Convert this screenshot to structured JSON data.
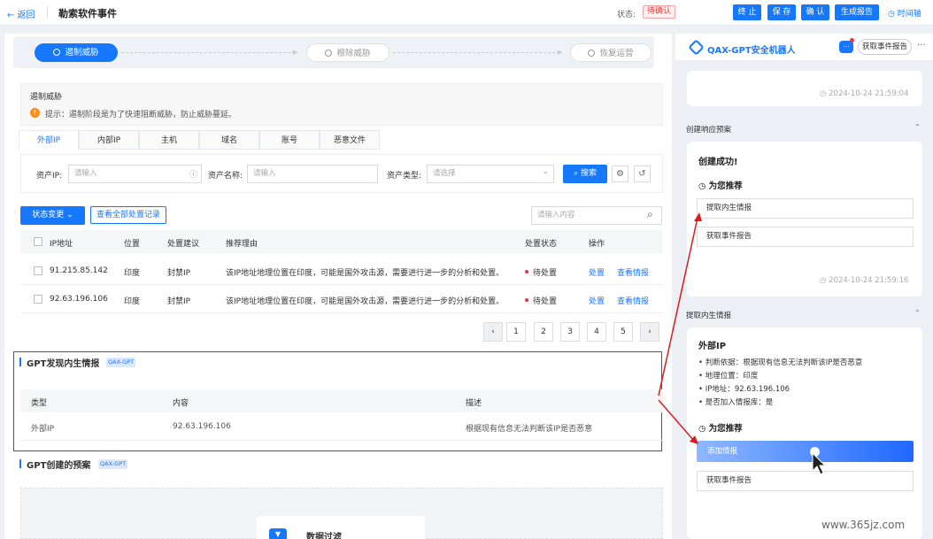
{
  "header": {
    "back": "← 返回",
    "title": "勒索软件事件",
    "status_label": "状态:",
    "status_value": "待确认",
    "btn_terminate": "终 止",
    "btn_save": "保 存",
    "btn_confirm": "确 认",
    "btn_report": "生成报告",
    "timeline": "时间轴"
  },
  "steps": {
    "active": "遏制威胁",
    "step2": "根除威胁",
    "step3": "恢复运营"
  },
  "stage": {
    "title": "遏制威胁",
    "tip": "提示：遏制阶段是为了快速阻断威胁，防止威胁蔓延。"
  },
  "tabs": [
    "外部IP",
    "内部IP",
    "主机",
    "域名",
    "账号",
    "恶意文件"
  ],
  "filter": {
    "ip_label": "资产IP:",
    "ip_placeholder": "请输入",
    "name_label": "资产名称:",
    "name_placeholder": "请输入",
    "type_label": "资产类型:",
    "type_placeholder": "请选择",
    "search": "搜索"
  },
  "actions": {
    "status_change": "状态变更",
    "view_all": "查看全部处置记录",
    "search_placeholder": "请输入内容"
  },
  "table": {
    "headers": [
      "IP地址",
      "位置",
      "处置建议",
      "推荐理由",
      "处置状态",
      "操作"
    ],
    "rows": [
      {
        "ip": "91.215.85.142",
        "location": "印度",
        "suggest": "封禁IP",
        "reason": "该IP地址地理位置在印度，可能是国外攻击源，需要进行进一步的分析和处置。",
        "status": "待处置",
        "op1": "处置",
        "op2": "查看情报"
      },
      {
        "ip": "92.63.196.106",
        "location": "印度",
        "suggest": "封禁IP",
        "reason": "该IP地址地理位置在印度，可能是国外攻击源，需要进行进一步的分析和处置。",
        "status": "待处置",
        "op1": "处置",
        "op2": "查看情报"
      }
    ]
  },
  "pagination": [
    "1",
    "2",
    "3",
    "4",
    "5"
  ],
  "gpt_intel": {
    "title": "GPT发现内生情报",
    "badge": "QAX-GPT",
    "headers": [
      "类型",
      "内容",
      "描述"
    ],
    "row": [
      "外部IP",
      "92.63.196.106",
      "根据现有信息无法判断该IP是否恶意"
    ]
  },
  "gpt_plan": {
    "title": "GPT创建的预案",
    "badge": "QAX-GPT",
    "flow_label": "数据过滤"
  },
  "robot": {
    "title": "QAX-GPT安全机器人",
    "report_btn": "获取事件报告",
    "more": "···",
    "ts1": "2024-10-24 21:59:04",
    "sec1": "创建响应预案",
    "created": "创建成功!",
    "recommend": "为您推荐",
    "rec1": "提取内生情报",
    "rec2": "获取事件报告",
    "ts2": "2024-10-24 21:59:16",
    "sec2": "提取内生情报",
    "ext_title": "外部IP",
    "bullets": [
      "判断依据：根据现有信息无法判断该IP是否恶意",
      "地理位置：印度",
      "IP地址：92.63.196.106",
      "是否加入情报库：是"
    ],
    "recommend2": "为您推荐",
    "add_intel": "添加情报",
    "rec3": "获取事件报告"
  },
  "watermark": "www.365jz.com",
  "colors": {
    "primary": "#1677ff",
    "highlight_red": "#d91c1c",
    "status_red": "#e5393a"
  }
}
